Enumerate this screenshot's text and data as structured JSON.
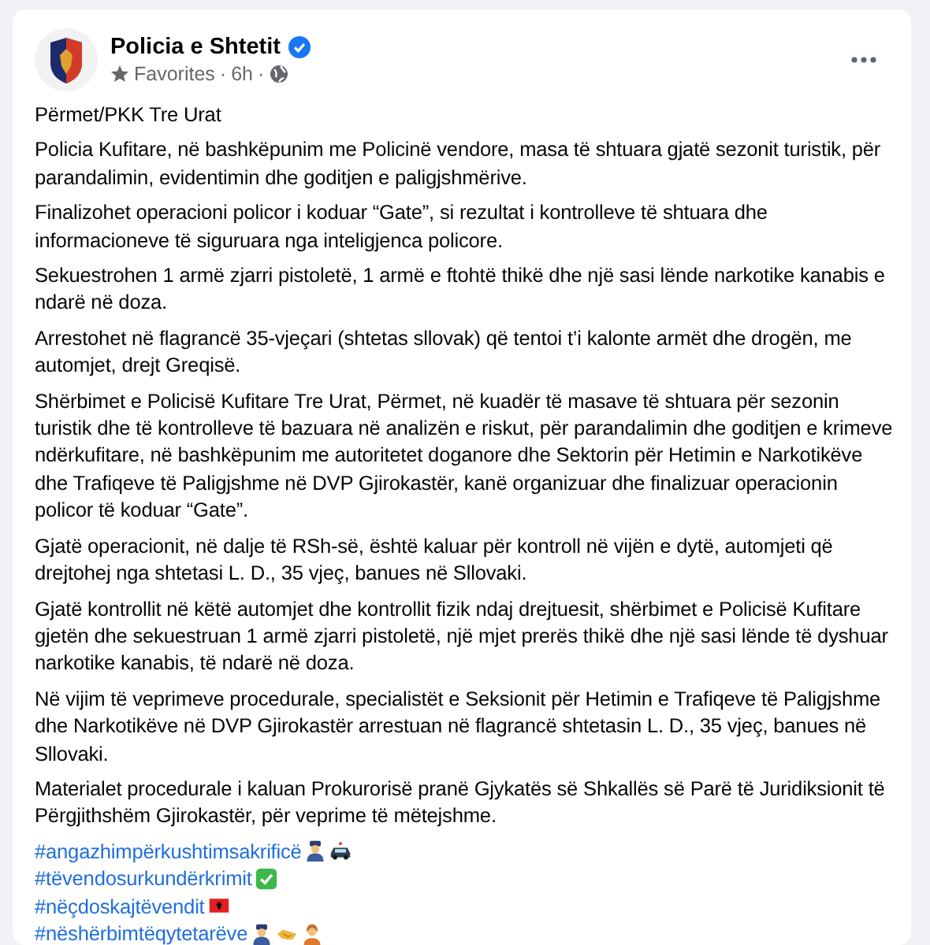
{
  "post": {
    "author": "Policia e Shtetit",
    "verified": true,
    "audience": "Favorites",
    "time": "6h",
    "separator": "·"
  },
  "paragraphs": [
    "Përmet/PKK Tre Urat",
    "Policia Kufitare, në bashkëpunim me Policinë vendore, masa të shtuara gjatë sezonit turistik, për parandalimin, evidentimin dhe goditjen e paligjshmërive.",
    "Finalizohet operacioni policor i koduar “Gate”, si rezultat i kontrolleve të shtuara dhe informacioneve të siguruara nga inteligjenca policore.",
    "Sekuestrohen 1 armë zjarri pistoletë, 1 armë e ftohtë thikë dhe një sasi lënde narkotike kanabis e ndarë në doza.",
    "Arrestohet në flagrancë 35-vjeçari (shtetas sllovak) që tentoi t’i kalonte armët dhe drogën, me automjet, drejt Greqisë.",
    "Shërbimet e Policisë Kufitare Tre Urat, Përmet, në kuadër të masave të shtuara për sezonin turistik dhe të kontrolleve të bazuara në analizën e riskut, për parandalimin dhe goditjen e krimeve ndërkufitare, në bashkëpunim me autoritetet doganore dhe Sektorin për Hetimin e Narkotikëve dhe Trafiqeve të Paligjshme në DVP Gjirokastër, kanë organizuar dhe finalizuar operacionin policor të koduar “Gate”.",
    "Gjatë operacionit, në dalje të RSh-së, është kaluar për kontroll në vijën e dytë, automjeti që drejtohej nga shtetasi L. D., 35 vjeç, banues në Sllovaki.",
    "Gjatë kontrollit në këtë automjet dhe kontrollit fizik ndaj drejtuesit, shërbimet e Policisë Kufitare gjetën dhe sekuestruan 1 armë zjarri pistoletë, një mjet prerës thikë dhe një sasi lënde të dyshuar narkotike kanabis, të ndarë në doza.",
    "Në vijim të veprimeve procedurale, specialistët e Seksionit për Hetimin e Trafiqeve të Paligjshme dhe Narkotikëve në DVP Gjirokastër arrestuan në flagrancë shtetasin L. D., 35 vjeç, banues në Sllovaki.",
    "Materialet procedurale i kaluan Prokurorisë pranë Gjykatës së Shkallës së Parë të Juridiksionit të Përgjithshëm Gjirokastër, për veprime të mëtejshme."
  ],
  "hashtags": [
    {
      "text": "#angazhimpërkushtimsakrificë"
    },
    {
      "text": "#tëvendosurkundërkrimit"
    },
    {
      "text": "#nëçdoskajtëvendit"
    },
    {
      "text": "#nëshërbimtëqytetarëve"
    }
  ]
}
